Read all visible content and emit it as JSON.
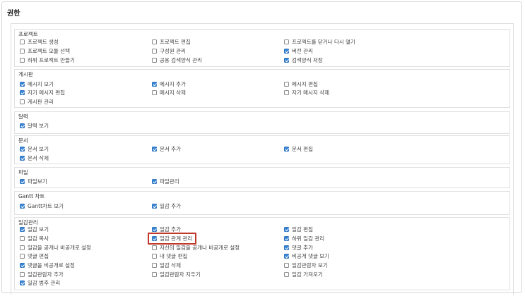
{
  "page_title": "권한",
  "groups": [
    {
      "title": "프로젝트",
      "items": [
        {
          "label": "프로젝트 생성",
          "checked": false
        },
        {
          "label": "프로젝트 편집",
          "checked": false
        },
        {
          "label": "프로젝트를 닫거나 다시 열기",
          "checked": false
        },
        {
          "label": "프로젝트 모듈 선택",
          "checked": false
        },
        {
          "label": "구성원 관리",
          "checked": false
        },
        {
          "label": "버전 관리",
          "checked": true
        },
        {
          "label": "하위 프로젝트 만들기",
          "checked": false
        },
        {
          "label": "공용 검색양식 관리",
          "checked": false
        },
        {
          "label": "검색양식 저장",
          "checked": true
        }
      ]
    },
    {
      "title": "게시판",
      "items": [
        {
          "label": "메시지 보기",
          "checked": true
        },
        {
          "label": "메시지 추가",
          "checked": true
        },
        {
          "label": "메시지 편집",
          "checked": false
        },
        {
          "label": "자기 메시지 편집",
          "checked": true
        },
        {
          "label": "메시지 삭제",
          "checked": false
        },
        {
          "label": "자기 메시지 삭제",
          "checked": false
        },
        {
          "label": "게시판 관리",
          "checked": false
        }
      ]
    },
    {
      "title": "달력",
      "items": [
        {
          "label": "달력 보기",
          "checked": true
        }
      ]
    },
    {
      "title": "문서",
      "items": [
        {
          "label": "문서 보기",
          "checked": true
        },
        {
          "label": "문서 추가",
          "checked": true
        },
        {
          "label": "문서 편집",
          "checked": true
        },
        {
          "label": "문서 삭제",
          "checked": true
        }
      ]
    },
    {
      "title": "파일",
      "items": [
        {
          "label": "파일보기",
          "checked": true
        },
        {
          "label": "파일관리",
          "checked": true
        }
      ]
    },
    {
      "title": "Gantt 차트",
      "items": [
        {
          "label": "Gantt차트 보기",
          "checked": true
        },
        {
          "label": "일감 추가",
          "checked": true
        }
      ]
    },
    {
      "title": "일감관리",
      "items": [
        {
          "label": "일감 보기",
          "checked": true
        },
        {
          "label": "일감 추가",
          "checked": true
        },
        {
          "label": "일감 편집",
          "checked": true
        },
        {
          "label": "일감 복사",
          "checked": false
        },
        {
          "label": "일감 관계 관리",
          "checked": true
        },
        {
          "label": "하위 일감 관리",
          "checked": true
        },
        {
          "label": "일감을 공개나 비공개로 설정",
          "checked": false
        },
        {
          "label": "자신의 일감을 공개나 비공개로 설정",
          "checked": false
        },
        {
          "label": "댓글 추가",
          "checked": true
        },
        {
          "label": "댓글 편집",
          "checked": false
        },
        {
          "label": "내 댓글 편집",
          "checked": false
        },
        {
          "label": "비공개 댓글 보기",
          "checked": true
        },
        {
          "label": "댓글을 비공개로 설정",
          "checked": true
        },
        {
          "label": "일감 삭제",
          "checked": false
        },
        {
          "label": "일감관람자 보기",
          "checked": false
        },
        {
          "label": "일감관람자 추가",
          "checked": false
        },
        {
          "label": "일감관람자 지우기",
          "checked": false
        },
        {
          "label": "일감 가져오기",
          "checked": false
        },
        {
          "label": "일감 범주 관리",
          "checked": true
        }
      ]
    }
  ]
}
